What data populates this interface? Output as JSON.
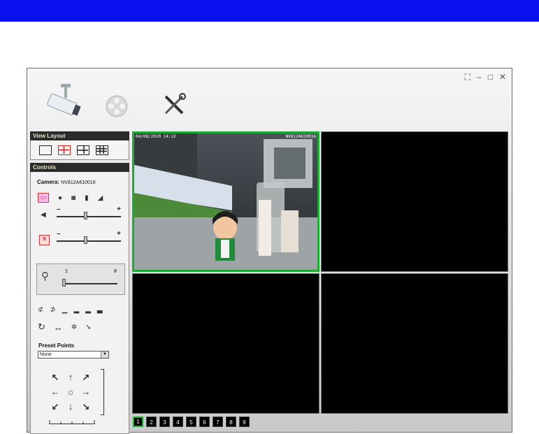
{
  "window_controls": {
    "fullscreen": "⛶",
    "minimize": "–",
    "maximize": "□",
    "close": "✕"
  },
  "toolbar": {
    "icons": [
      "camera-icon",
      "film-reel-icon",
      "tools-icon"
    ]
  },
  "view_layout": {
    "title": "View Layout",
    "options": [
      "single",
      "quad",
      "six",
      "nine"
    ],
    "selected": "quad"
  },
  "controls": {
    "title": "Controls",
    "camera_label": "Camera:",
    "camera_id": "NV812A610016",
    "volume_min": "–",
    "volume_max": "+",
    "volume_level": 0.45,
    "mic_min": "–",
    "mic_max": "+",
    "mic_level": 0.45,
    "zoom_min": "1",
    "zoom_max": "8",
    "zoom_level": 1,
    "preset_label": "Preset Points",
    "preset_value": "None"
  },
  "video": {
    "tile1_timestamp": "04/08/2010 14:22",
    "tile1_camera": "NV812A610016",
    "active_tile": 1
  },
  "pages": [
    "1",
    "2",
    "3",
    "4",
    "5",
    "6",
    "7",
    "8",
    "9"
  ],
  "selected_page": "1",
  "colors": {
    "banner": "#0a10ee",
    "active": "#20a83a",
    "accent": "#d0201f"
  }
}
